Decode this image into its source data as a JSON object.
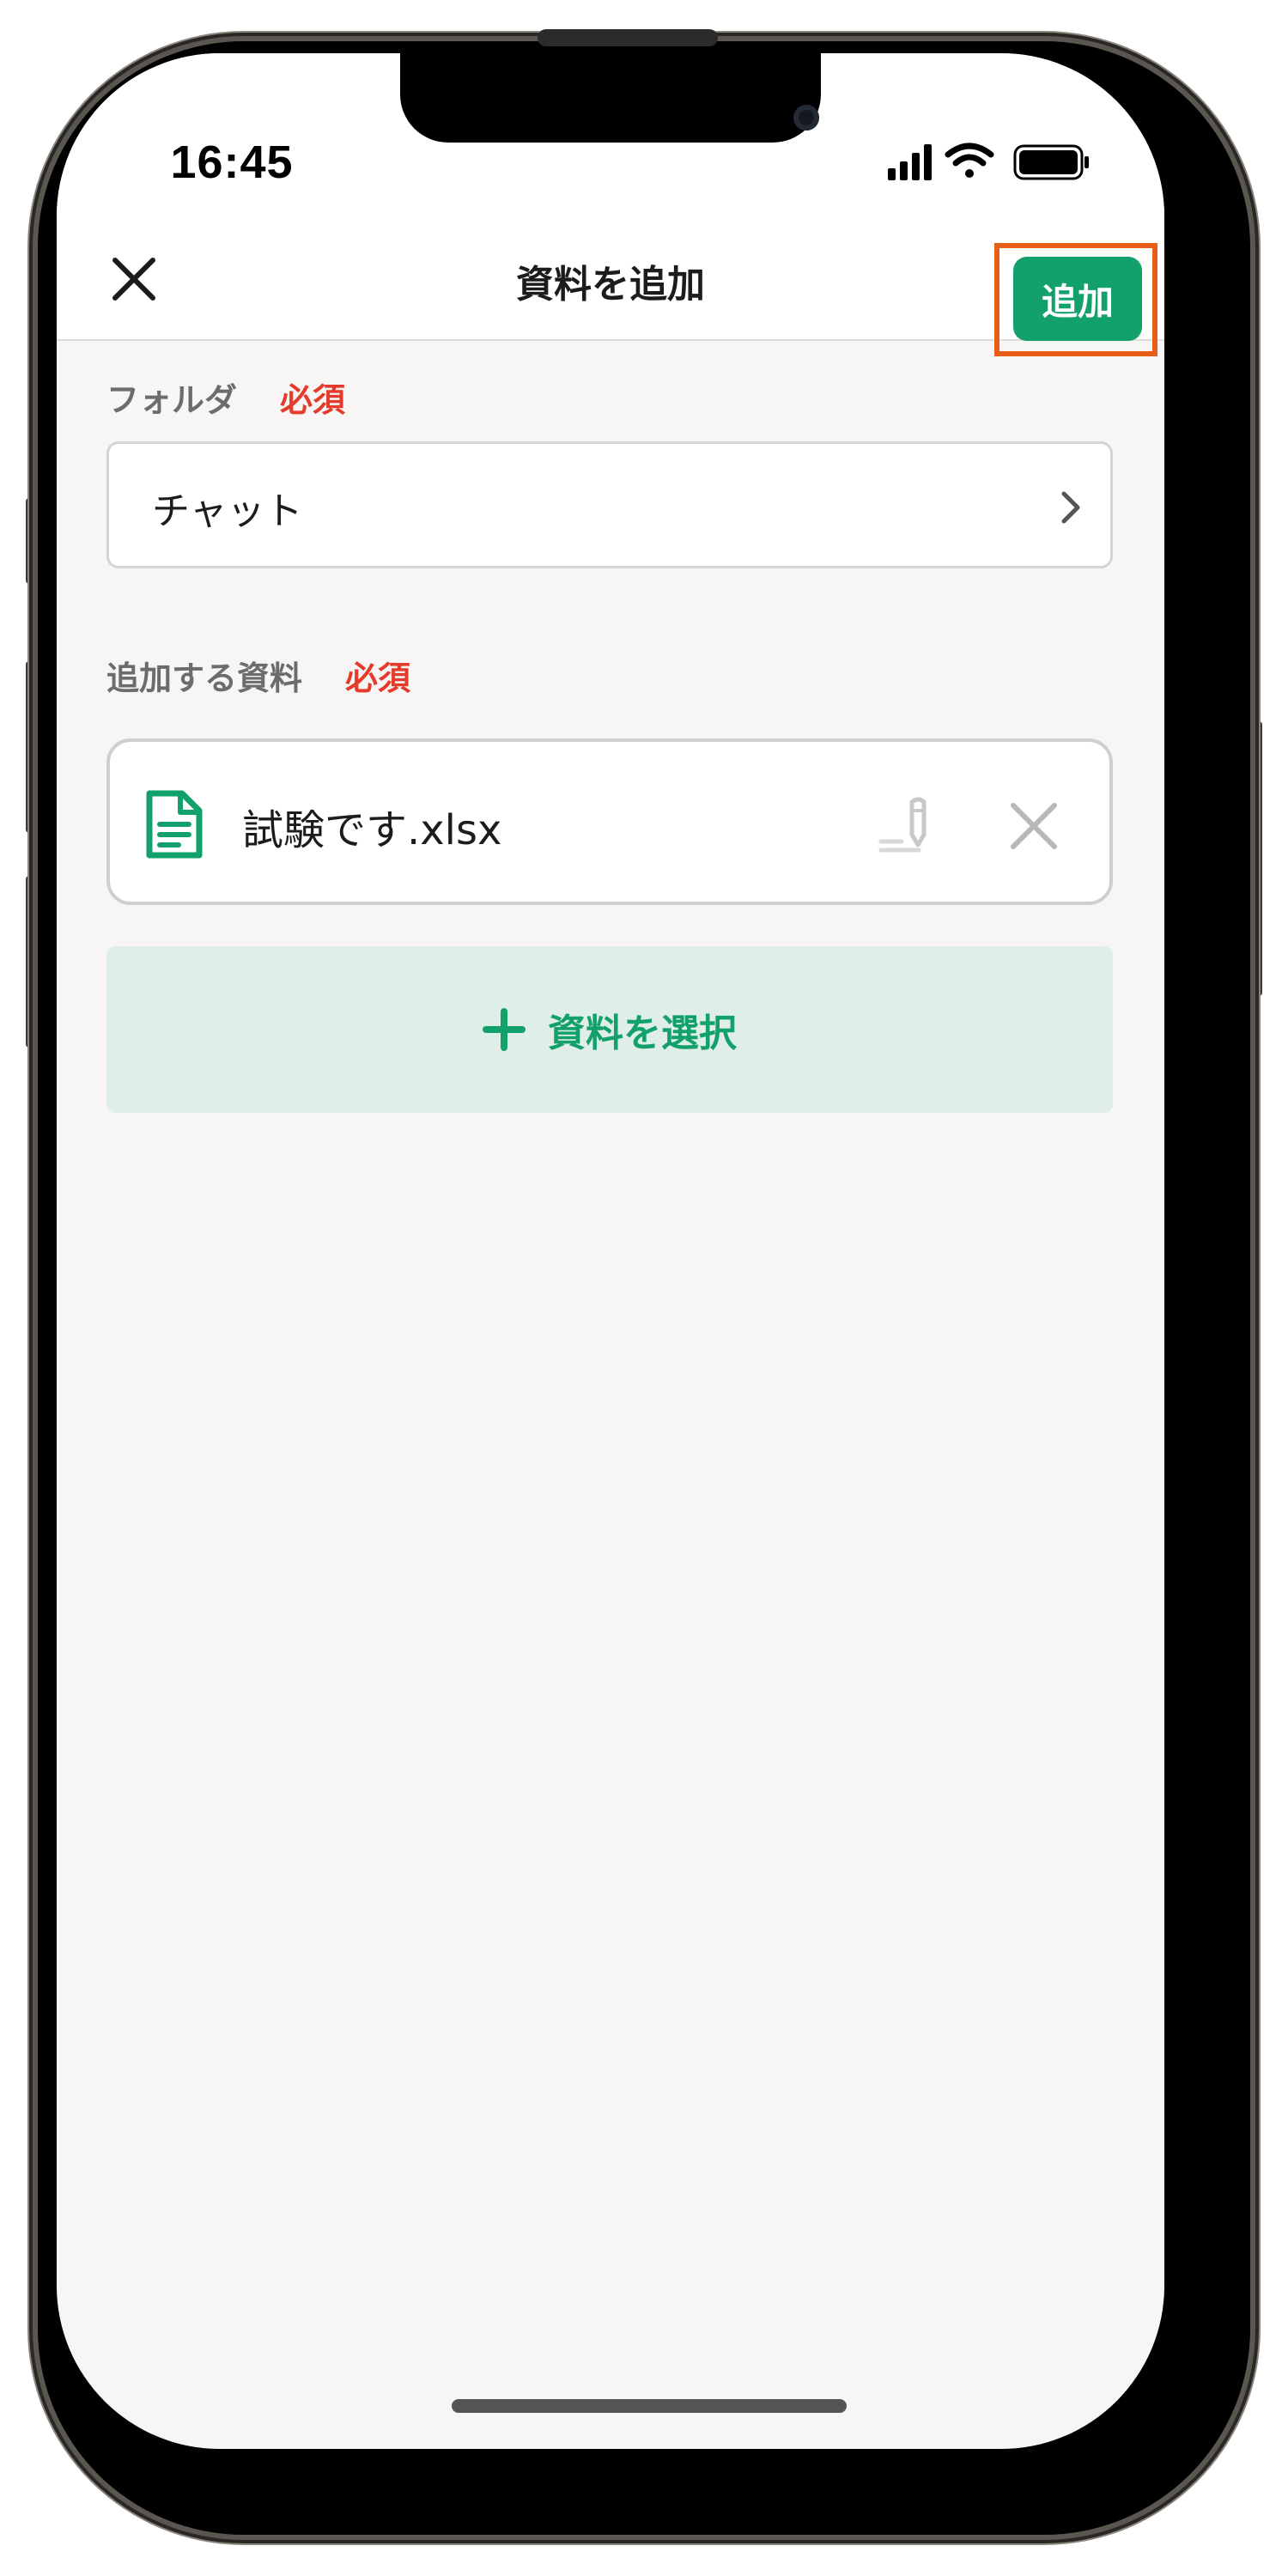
{
  "status_bar": {
    "time": "16:45",
    "icons": [
      "signal-icon",
      "wifi-icon",
      "battery-icon"
    ]
  },
  "navbar": {
    "title": "資料を追加",
    "add_label": "追加",
    "close_icon": "close-icon"
  },
  "form": {
    "folder": {
      "label": "フォルダ",
      "required": "必須",
      "value": "チャット",
      "icon": "chevron-right-icon"
    },
    "materials": {
      "label": "追加する資料",
      "required": "必須",
      "files": [
        {
          "name": "試験です.xlsx",
          "icon": "document-icon"
        }
      ],
      "select_label": "資料を選択",
      "select_icon": "plus-icon"
    }
  },
  "colors": {
    "accent": "#12a06b",
    "required": "#e43b2c",
    "highlight": "#e85d16",
    "background": "#f7f6f4"
  }
}
